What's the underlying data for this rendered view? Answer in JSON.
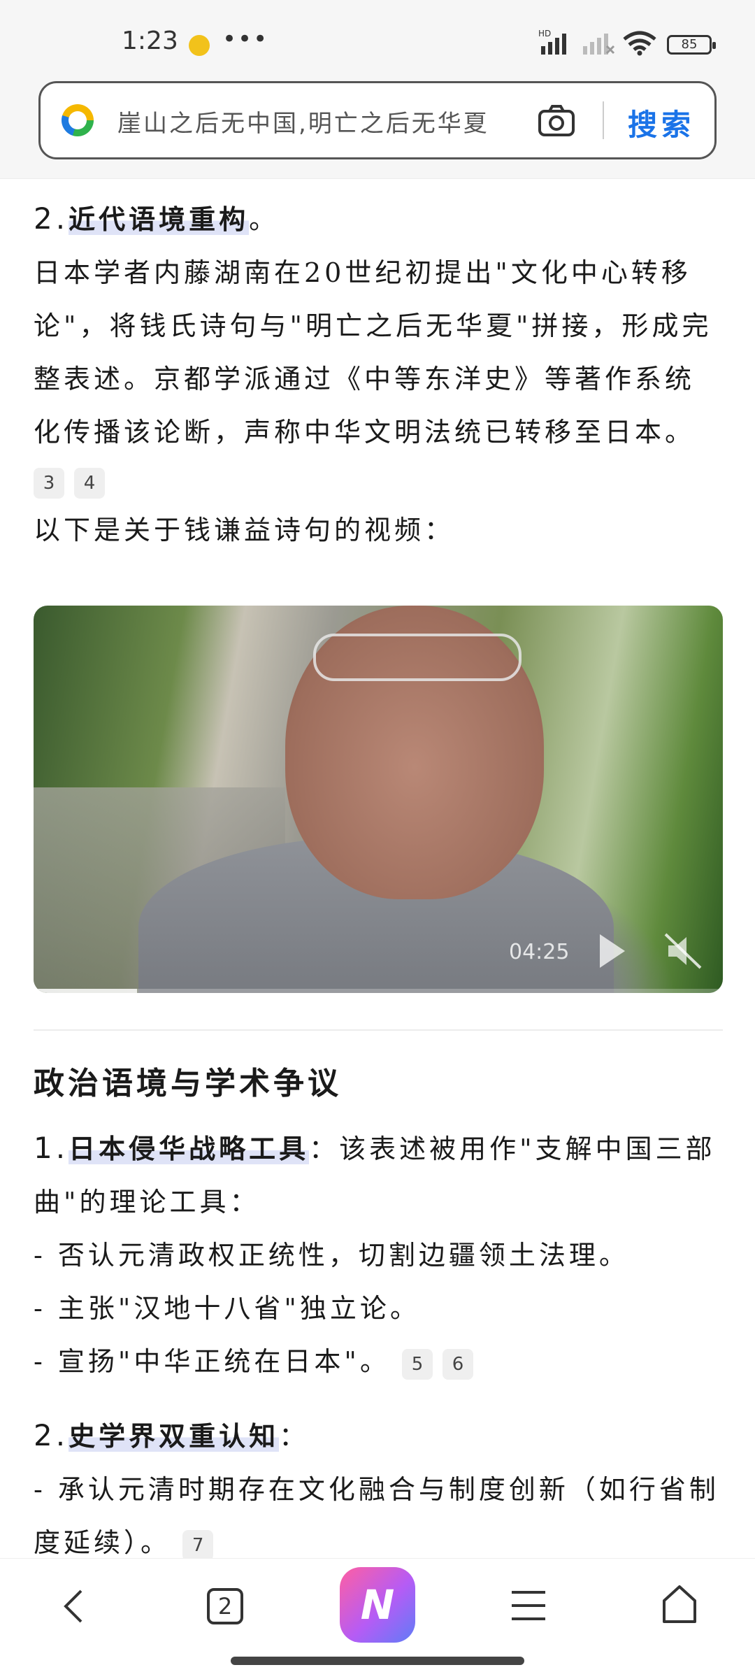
{
  "status_bar": {
    "time": "1:23",
    "more": "•••",
    "battery": "85",
    "hd_label": "HD"
  },
  "search": {
    "query": "崖山之后无中国,明亡之后无华夏",
    "button_label": "搜索"
  },
  "article": {
    "item2": {
      "number": "2.",
      "title": "近代语境重构",
      "title_suffix": "。",
      "body": "日本学者内藤湖南在20世纪初提出\"文化中心转移论\"，将钱氏诗句与\"明亡之后无华夏\"拼接，形成完整表述。京都学派通过《中等东洋史》等著作系统化传播该论断，声称中华文明法统已转移至日本。",
      "refs": [
        "3",
        "4"
      ]
    },
    "video_intro": "以下是关于钱谦益诗句的视频：",
    "video": {
      "duration": "04:25",
      "progress_fraction": 0.15
    },
    "section_title": "政治语境与学术争议",
    "point1": {
      "number": "1.",
      "title": "日本侵华战略工具",
      "body": "：该表述被用作\"支解中国三部曲\"的理论工具：",
      "bullets": [
        "- 否认元清政权正统性，切割边疆领土法理。",
        "- 主张\"汉地十八省\"独立论。",
        "- 宣扬\"中华正统在日本\"。"
      ],
      "refs": [
        "5",
        "6"
      ]
    },
    "point2": {
      "number": "2.",
      "title": "史学界双重认知",
      "body": "：",
      "bullets": [
        "- 承认元清时期存在文化融合与制度创新（如行省制度延续）。"
      ],
      "refs": [
        "7"
      ]
    }
  },
  "bottom_nav": {
    "tabs_count": "2",
    "ai_label": "N"
  },
  "colors": {
    "accent": "#1a73e8",
    "highlight": "#dfe3f7"
  }
}
